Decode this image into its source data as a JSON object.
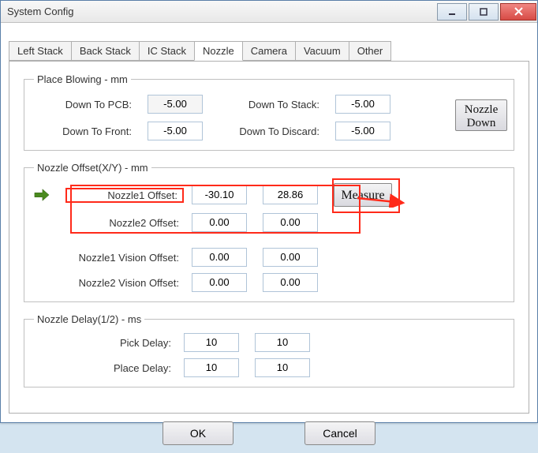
{
  "window": {
    "title": "System Config"
  },
  "tabs": [
    "Left Stack",
    "Back Stack",
    "IC Stack",
    "Nozzle",
    "Camera",
    "Vacuum",
    "Other"
  ],
  "active_tab": "Nozzle",
  "place_blowing": {
    "legend": "Place Blowing - mm",
    "down_to_pcb_label": "Down To PCB:",
    "down_to_pcb": "-5.00",
    "down_to_stack_label": "Down To Stack:",
    "down_to_stack": "-5.00",
    "down_to_front_label": "Down To Front:",
    "down_to_front": "-5.00",
    "down_to_discard_label": "Down To Discard:",
    "down_to_discard": "-5.00",
    "nozzle_down_label": "Nozzle Down"
  },
  "nozzle_offset": {
    "legend": "Nozzle Offset(X/Y) - mm",
    "nozzle1_label": "Nozzle1 Offset:",
    "nozzle1_x": "-30.10",
    "nozzle1_y": "28.86",
    "nozzle2_label": "Nozzle2 Offset:",
    "nozzle2_x": "0.00",
    "nozzle2_y": "0.00",
    "measure_label": "Measure",
    "nozzle1_vision_label": "Nozzle1 Vision Offset:",
    "nozzle1_vision_x": "0.00",
    "nozzle1_vision_y": "0.00",
    "nozzle2_vision_label": "Nozzle2 Vision Offset:",
    "nozzle2_vision_x": "0.00",
    "nozzle2_vision_y": "0.00"
  },
  "nozzle_delay": {
    "legend": "Nozzle Delay(1/2) - ms",
    "pick_label": "Pick Delay:",
    "pick_1": "10",
    "pick_2": "10",
    "place_label": "Place Delay:",
    "place_1": "10",
    "place_2": "10"
  },
  "footer": {
    "ok": "OK",
    "cancel": "Cancel"
  },
  "annotation": {
    "highlight_color": "#ff2a1a"
  }
}
